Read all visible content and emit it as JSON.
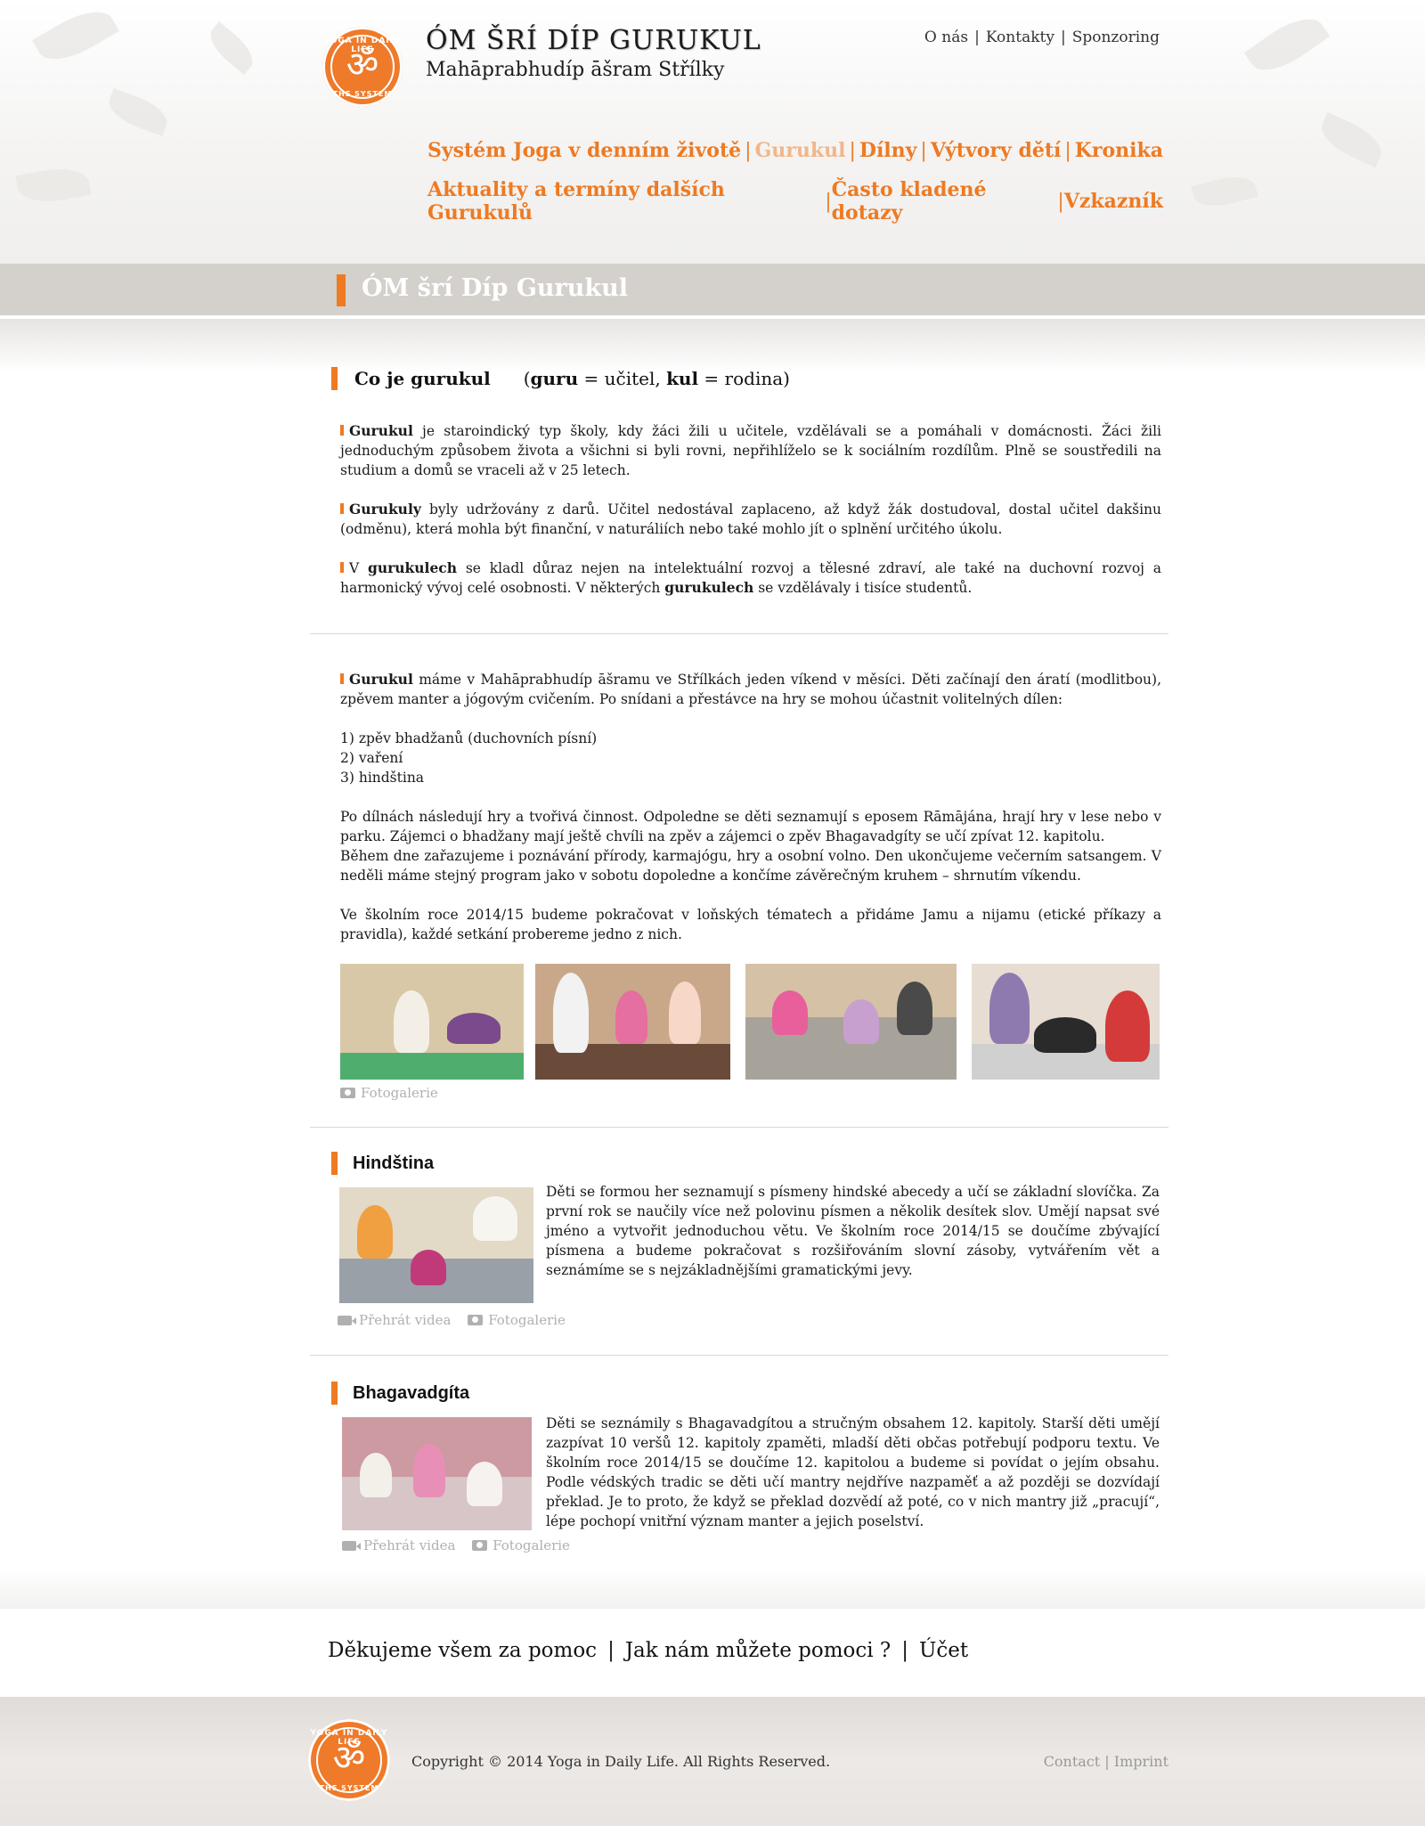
{
  "header": {
    "logo_top_text": "YOGA IN DAILY LIFE",
    "logo_bottom_text": "THE SYSTEM",
    "logo_symbol": "ॐ",
    "title": "ÓM  ŠRÍ DÍP  GURUKUL",
    "subtitle": "Mahāprabhudíp āšram Střílky",
    "top_links": [
      "O nás",
      "Kontakty",
      "Sponzoring"
    ],
    "top_seps": [
      "|",
      "|"
    ],
    "nav_row1": [
      "Systém Joga v denním životě",
      "Gurukul",
      "Dílny",
      "Výtvory dětí",
      "Kronika"
    ],
    "nav_row2": [
      "Aktuality a termíny dalších Gurukulů",
      "Často kladené dotazy",
      "Vzkazník"
    ],
    "nav_sep": "|",
    "active_nav": "Gurukul"
  },
  "page_title": "ÓM šrí Díp Gurukul",
  "intro": {
    "heading": "Co je gurukul",
    "definition_guru": "guru",
    "definition_guru_meaning": " = učitel, ",
    "definition_kul": "kul",
    "definition_kul_meaning": " = rodina)",
    "definition_open": "(",
    "p1_bold": "Gurukul",
    "p1_text": "  je staroindický typ školy, kdy žáci žili u učitele, vzdělávali se a pomáhali v domácnosti. Žáci žili  jednoduchým způsobem života a všichni si byli rovni, nepřihlíželo se k sociálním rozdílům. Plně se soustředili na studium a domů se vraceli až v 25 letech.",
    "p2_bold": "Gurukuly",
    "p2_text": "  byly udržovány z darů. Učitel nedostával zaplaceno, až když žák dostudoval, dostal učitel dakšinu (odměnu), která mohla být finanční, v naturáliích nebo také mohlo jít o splnění určitého úkolu.",
    "p3_pre": "V ",
    "p3_bold1": "gurukulech",
    "p3_mid": " se kladl důraz nejen na  intelektuální rozvoj  a tělesné zdraví, ale také na duchovní  rozvoj a harmonický vývoj celé osobnosti. V některých ",
    "p3_bold2": "gurukulech",
    "p3_end": " se vzdělávaly i tisíce studentů."
  },
  "program": {
    "p1_bold": "Gurukul",
    "p1_text": " máme  v Mahāprabhudíp āšramu ve Střílkách jeden víkend v měsíci. Děti začínají den áratí (modlitbou), zpěvem manter a jógovým cvičením. Po snídani a přestávce na hry se mohou účastnit volitelných dílen:",
    "list": [
      "1) zpěv bhadžanů (duchovních písní)",
      "2) vaření",
      "3) hindština"
    ],
    "p2": "Po dílnách následují hry a tvořivá činnost. Odpoledne se děti seznamují s eposem Rāmājána, hrají hry v lese nebo v parku. Zájemci o bhadžany mají ještě chvíli na zpěv a zájemci o zpěv Bhagavadgíty se učí zpívat 12. kapitolu.",
    "p3": "Během dne zařazujeme i poznávání přírody, karmajógu, hry a osobní volno.  Den ukončujeme večerním satsangem. V neděli máme stejný program jako v sobotu dopoledne a končíme závěrečným kruhem – shrnutím víkendu.",
    "p4": "Ve školním roce 2014/15 budeme pokračovat v loňských tématech a přidáme Jamu a nijamu (etické příkazy a pravidla), každé setkání probereme jedno z nich.",
    "gallery_link": "Fotogalerie"
  },
  "hindi": {
    "heading": "Hindština",
    "text": "Děti se formou her seznamují s písmeny hindské abecedy a učí se základní slovíčka. Za první rok se naučily více než polovinu písmen a několik desítek slov. Umějí napsat své jméno a vytvořit jednoduchou větu. Ve školním roce 2014/15 se doučíme zbývající písmena a budeme pokračovat s rozšiřováním slovní zásoby, vytvářením vět a seznámíme se s nejzákladnějšími gramatickými jevy.",
    "video_link": "Přehrát videa",
    "gallery_link": "Fotogalerie"
  },
  "bhagavadgita": {
    "heading": "Bhagavadgíta",
    "text": "Děti se seznámily s Bhagavadgítou a stručným obsahem 12. kapitoly.  Starší děti umějí zazpívat 10 veršů 12. kapitoly zpaměti, mladší děti občas potřebují podporu textu. Ve školním roce 2014/15 se doučíme 12. kapitolou a budeme si povídat o jejím obsahu. Podle védských tradic se děti učí mantry nejdříve nazpaměť a až později se dozvídají překlad. Je to proto, že když se překlad dozvědí až poté, co v nich mantry již „pracují“, lépe pochopí vnitřní význam manter a jejich poselství.",
    "video_link": "Přehrát videa",
    "gallery_link": "Fotogalerie"
  },
  "footer_links": {
    "items": [
      "Děkujeme všem za pomoc",
      "Jak nám můžete pomoci ?",
      "Účet"
    ],
    "sep": "|"
  },
  "footer": {
    "copyright": "Copyright © 2014 Yoga in Daily Life. All Rights Reserved.",
    "links": [
      "Contact",
      "Imprint"
    ],
    "sep": "|"
  },
  "colors": {
    "accent": "#ee7a22",
    "active_nav": "#f3b58a",
    "band": "#d4d0cb"
  },
  "icons": [
    "camera-icon",
    "video-icon"
  ]
}
